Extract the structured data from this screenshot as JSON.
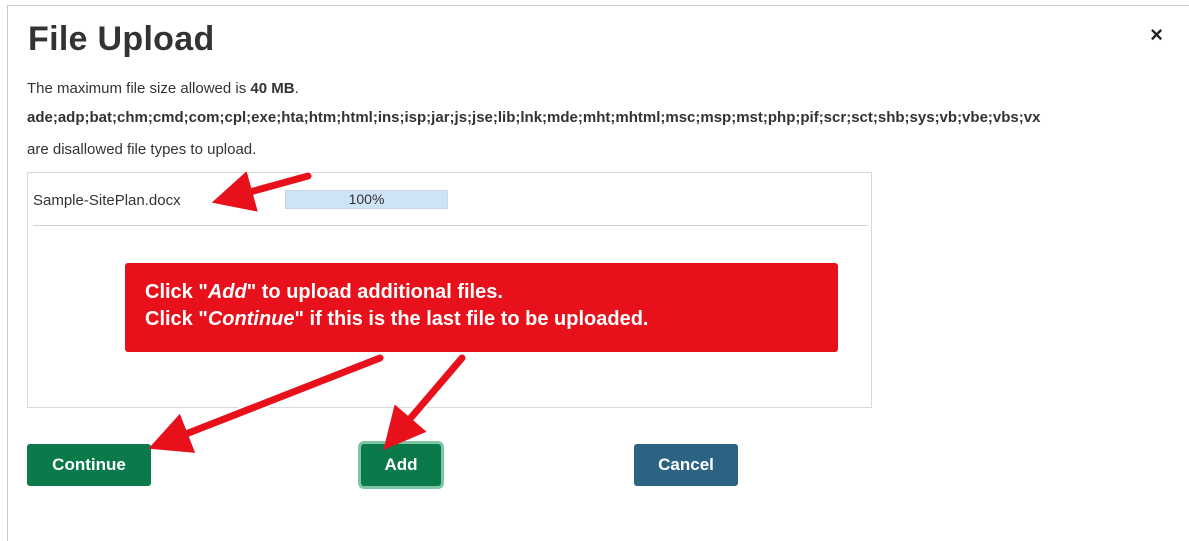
{
  "dialog": {
    "title": "File Upload",
    "close_label": "×",
    "max_size_prefix": "The maximum file size allowed is ",
    "max_size_value": "40 MB",
    "max_size_suffix": ".",
    "disallowed_types": "ade;adp;bat;chm;cmd;com;cpl;exe;hta;htm;html;ins;isp;jar;js;jse;lib;lnk;mde;mht;mhtml;msc;msp;mst;php;pif;scr;sct;shb;sys;vb;vbe;vbs;vx",
    "disallowed_suffix": "are disallowed file types to upload."
  },
  "upload": {
    "files": [
      {
        "name": "Sample-SitePlan.docx",
        "progress_text": "100%",
        "progress_fraction": 1.0
      }
    ]
  },
  "buttons": {
    "continue": "Continue",
    "add": "Add",
    "cancel": "Cancel"
  },
  "callout": {
    "line1_prefix": "Click \"",
    "line1_emphasis": "Add",
    "line1_suffix": "\" to upload additional files.",
    "line2_prefix": "Click \"",
    "line2_emphasis": "Continue",
    "line2_suffix": "\" if this is the last file to be uploaded."
  },
  "colors": {
    "primary_button": "#0a7a4b",
    "cancel_button": "#2c6382",
    "callout_red": "#e8111b",
    "progress_fill": "#cfe3f7"
  }
}
